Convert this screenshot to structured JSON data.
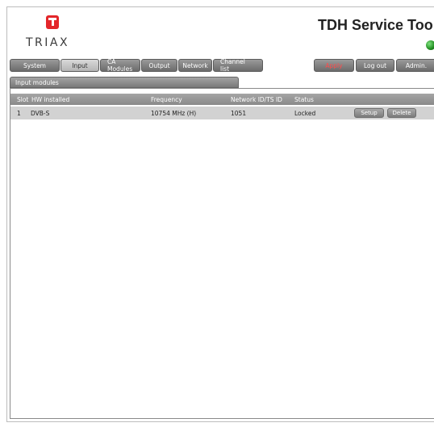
{
  "brand": {
    "logo_text": "TRIAX",
    "accent": "#e3262a"
  },
  "app": {
    "title": "TDH Service Tool",
    "status_led_color": "#2aa52a"
  },
  "tabs": [
    {
      "label": "System",
      "active": false
    },
    {
      "label": "Input",
      "active": true
    },
    {
      "label": "CA Modules",
      "active": false
    },
    {
      "label": "Output",
      "active": false
    },
    {
      "label": "Network",
      "active": false
    },
    {
      "label": "Channel list",
      "active": false
    }
  ],
  "actions": {
    "apply": "Apply",
    "logout": "Log out",
    "admin": "Admin."
  },
  "section": {
    "title": "Input modules"
  },
  "table": {
    "columns": [
      "Slot",
      "HW installed",
      "Frequency",
      "Network ID/TS ID",
      "Status"
    ],
    "rows": [
      {
        "slot": "1",
        "hw": "DVB-S",
        "frequency": "10754 MHz (H)",
        "network": "1051",
        "status": "Locked",
        "setup_label": "Setup",
        "delete_label": "Delete"
      }
    ]
  }
}
